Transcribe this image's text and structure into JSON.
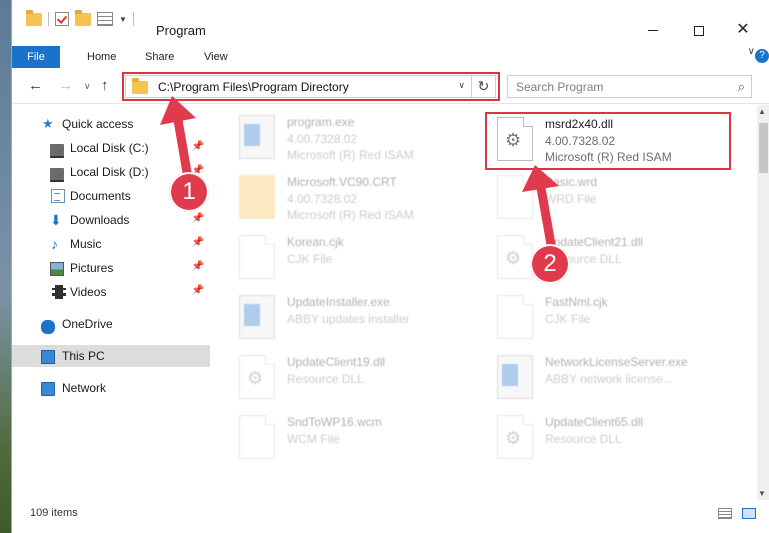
{
  "window": {
    "title": "Program",
    "min_glyph": "—",
    "close_glyph": "✕"
  },
  "ribbon": {
    "tabs": [
      "File",
      "Home",
      "Share",
      "View"
    ],
    "chevron_glyph": "∨",
    "help_glyph": "?"
  },
  "nav": {
    "back_glyph": "←",
    "forward_glyph": "→",
    "recent_glyph": "∨",
    "up_glyph": "↑"
  },
  "address": {
    "path": "C:\\Program Files\\Program Directory",
    "dropdown_glyph": "∨",
    "refresh_glyph": "↻"
  },
  "search": {
    "placeholder": "Search Program",
    "icon_glyph": "⌕"
  },
  "sidebar": {
    "items": [
      {
        "label": "Quick access",
        "icon": "star-icon",
        "pinned": false
      },
      {
        "label": "Local Disk (C:)",
        "icon": "disk-icon",
        "pinned": true
      },
      {
        "label": "Local Disk (D:)",
        "icon": "disk-icon",
        "pinned": true
      },
      {
        "label": "Documents",
        "icon": "document-icon",
        "pinned": true
      },
      {
        "label": "Downloads",
        "icon": "download-icon",
        "pinned": true
      },
      {
        "label": "Music",
        "icon": "music-icon",
        "pinned": true
      },
      {
        "label": "Pictures",
        "icon": "pictures-icon",
        "pinned": true
      },
      {
        "label": "Videos",
        "icon": "videos-icon",
        "pinned": true
      },
      {
        "label": "OneDrive",
        "icon": "cloud-icon",
        "pinned": false
      },
      {
        "label": "This PC",
        "icon": "computer-icon",
        "pinned": false,
        "selected": true
      },
      {
        "label": "Network",
        "icon": "network-icon",
        "pinned": false
      }
    ],
    "pin_glyph": "📌",
    "star_glyph": "★",
    "download_glyph": "⬇",
    "music_glyph": "♪"
  },
  "files": {
    "left": [
      {
        "name": "program.exe",
        "line2": "4.00.7328.02",
        "line3": "Microsoft (R) Red ISAM",
        "icon": "installer-icon"
      },
      {
        "name": "Microsoft.VC90.CRT",
        "line2": "4.00.7328.02",
        "line3": "Microsoft (R) Red ISAM",
        "icon": "folder-icon"
      },
      {
        "name": "Korean.cjk",
        "line2": "CJK File",
        "line3": "",
        "icon": "file-icon"
      },
      {
        "name": "UpdateInstaller.exe",
        "line2": "ABBY updates installer",
        "line3": "",
        "icon": "application-icon"
      },
      {
        "name": "UpdateClient19.dll",
        "line2": "Resource DLL",
        "line3": "",
        "icon": "dll-icon"
      },
      {
        "name": "SndToWP16.wcm",
        "line2": "WCM File",
        "line3": "",
        "icon": "file-icon"
      }
    ],
    "right": [
      {
        "name": "msrd2x40.dll",
        "line2": "4.00.7328.02",
        "line3": "Microsoft (R) Red ISAM",
        "icon": "dll-icon",
        "highlighted": true
      },
      {
        "name": "Basic.wrd",
        "line2": "WRD File",
        "line3": "",
        "icon": "file-icon"
      },
      {
        "name": "UpdateClient21.dll",
        "line2": "Resource DLL",
        "line3": "",
        "icon": "dll-icon"
      },
      {
        "name": "FastNml.cjk",
        "line2": "CJK File",
        "line3": "",
        "icon": "file-icon"
      },
      {
        "name": "NetworkLicenseServer.exe",
        "line2": "ABBY network license...",
        "line3": "",
        "icon": "application-icon"
      },
      {
        "name": "UpdateClient65.dll",
        "line2": "Resource DLL",
        "line3": "",
        "icon": "dll-icon"
      }
    ]
  },
  "status": {
    "item_count": "109 items"
  },
  "callouts": [
    {
      "label": "1",
      "target": "address-bar"
    },
    {
      "label": "2",
      "target": "msrd2x40.dll"
    }
  ],
  "colors": {
    "accent": "#1a73c9",
    "highlight": "#d93545",
    "selection": "#dcdcdc"
  }
}
